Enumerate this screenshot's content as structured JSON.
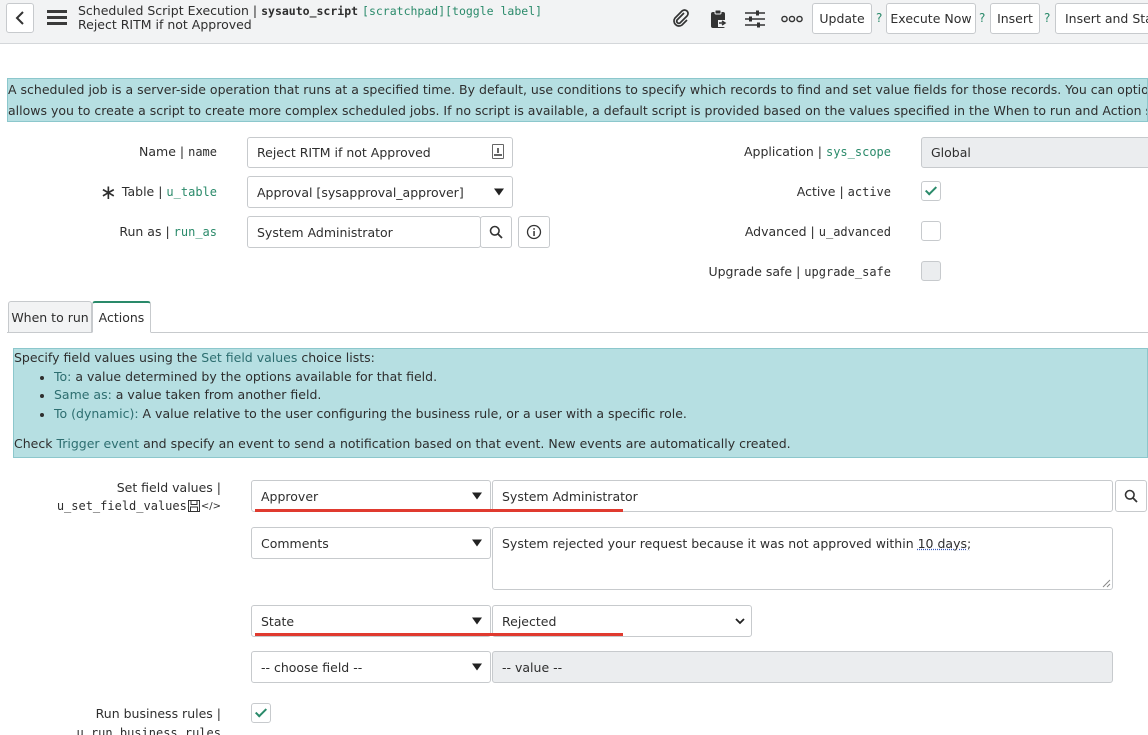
{
  "header": {
    "form_title": "Scheduled Script Execution",
    "sep": "|",
    "table_name": "sysauto_script",
    "context_tags": "[scratchpad][toggle label]",
    "record_name": "Reject RITM if not Approved",
    "buttons": {
      "update": "Update",
      "execute_now": "Execute Now",
      "insert": "Insert",
      "insert_and_stay": "Insert and Stay",
      "help": "?"
    },
    "icons": [
      "back-icon",
      "menu-icon",
      "paperclip-icon",
      "clipboard-icon",
      "sliders-icon",
      "more-icon"
    ]
  },
  "info_banner": {
    "line1": "A scheduled job is a server-side operation that runs at a specified time. By default, use conditions to specify which records to find and set value fields for those records. You can optionally trigger an event to send a",
    "line2": "allows you to create a script to create more complex scheduled jobs. If no script is available, a default script is provided based on the values specified in the When to run and Action section."
  },
  "form": {
    "name": {
      "label": "Name",
      "field": "name",
      "value": "Reject RITM if not Approved"
    },
    "table": {
      "label": "Table",
      "field": "u_table",
      "value": "Approval [sysapproval_approver]",
      "required_mark": "∗"
    },
    "run_as": {
      "label": "Run as",
      "field": "run_as",
      "value": "System Administrator"
    },
    "application": {
      "label": "Application",
      "field": "sys_scope",
      "value": "Global"
    },
    "active": {
      "label": "Active",
      "field": "active",
      "checked": true
    },
    "advanced": {
      "label": "Advanced",
      "field": "u_advanced",
      "checked": false
    },
    "upgrade_safe": {
      "label": "Upgrade safe",
      "field": "upgrade_safe",
      "checked": false
    }
  },
  "tabs": [
    {
      "label": "When to run",
      "active": false
    },
    {
      "label": "Actions",
      "active": true
    }
  ],
  "actions_banner": {
    "intro_pre": "Specify field values using the ",
    "intro_link": "Set field values",
    "intro_post": " choice lists:",
    "bullets": [
      {
        "term": "To:",
        "text": " a value determined by the options available for that field."
      },
      {
        "term": "Same as:",
        "text": " a value taken from another field."
      },
      {
        "term": "To (dynamic):",
        "text": " A value relative to the user configuring the business rule, or a user with a specific role."
      }
    ],
    "check_pre": "Check ",
    "check_link": "Trigger event",
    "check_post": " and specify an event to send a notification based on that event. New events are automatically created."
  },
  "set_field_values": {
    "label": "Set field values",
    "sep": "|",
    "field": "u_set_field_values",
    "rows": [
      {
        "field": "Approver",
        "value": "System Administrator"
      },
      {
        "field": "Comments",
        "value_pre": "System rejected your request because it was not approved within ",
        "value_num": "10",
        "value_post": " days;"
      },
      {
        "field": "State",
        "value": "Rejected"
      },
      {
        "field": "-- choose field --",
        "value": "-- value --"
      }
    ]
  },
  "run_business_rules": {
    "label": "Run business rules",
    "sep": "|",
    "field": "u_run_business_rules",
    "checked": true
  },
  "colors": {
    "accent": "#2a8a6a",
    "banner": "#b6dfe2",
    "highlight": "#e03a2f"
  }
}
